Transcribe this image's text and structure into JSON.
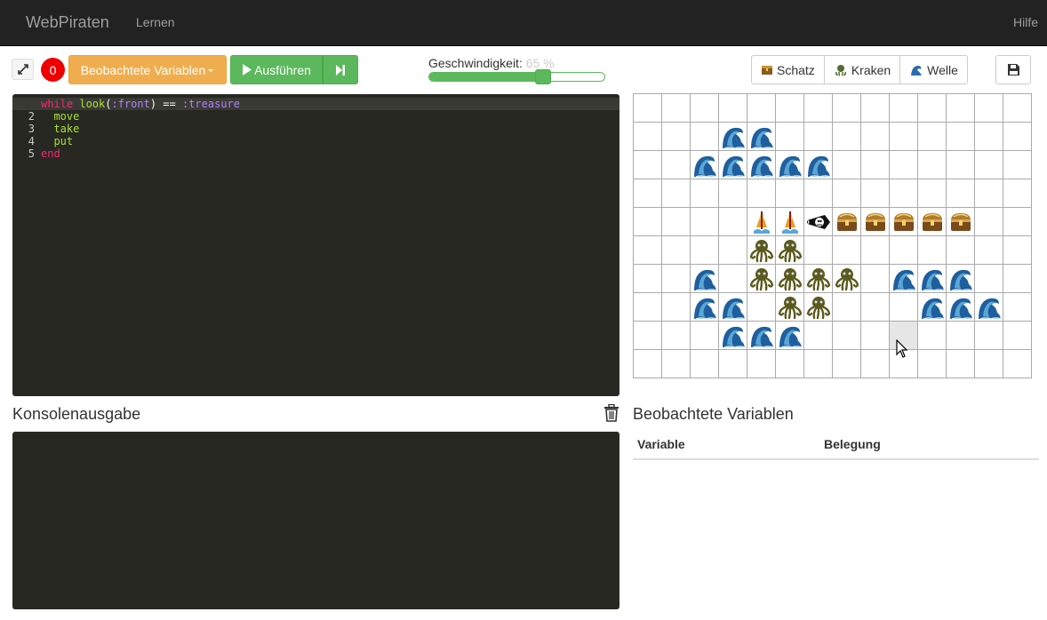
{
  "nav": {
    "brand": "WebPiraten",
    "learn": "Lernen",
    "help": "Hilfe"
  },
  "toolbar": {
    "error_count": "0",
    "watch_label": "Beobachtete Variablen",
    "run_label": "Ausführen",
    "speed_label": "Geschwindigkeit:",
    "speed_value": "65 %",
    "speed_level": 0.65,
    "treasure_label": "Schatz",
    "kraken_label": "Kraken",
    "wave_label": "Welle"
  },
  "editor": {
    "line_numbers": [
      "1",
      "2",
      "3",
      "4",
      "5"
    ]
  },
  "console": {
    "title": "Konsolenausgabe"
  },
  "watch": {
    "title": "Beobachtete Variablen",
    "col_variable": "Variable",
    "col_value": "Belegung"
  },
  "grid": {
    "cols": 14,
    "rows": 10,
    "cells": [
      [
        1,
        3,
        "wave"
      ],
      [
        1,
        4,
        "wave"
      ],
      [
        2,
        2,
        "wave"
      ],
      [
        2,
        3,
        "wave"
      ],
      [
        2,
        4,
        "wave"
      ],
      [
        2,
        5,
        "wave"
      ],
      [
        2,
        6,
        "wave"
      ],
      [
        4,
        4,
        "buoy"
      ],
      [
        4,
        5,
        "buoy"
      ],
      [
        4,
        6,
        "ship"
      ],
      [
        4,
        7,
        "treasure"
      ],
      [
        4,
        8,
        "treasure"
      ],
      [
        4,
        9,
        "treasure"
      ],
      [
        4,
        10,
        "treasure"
      ],
      [
        4,
        11,
        "treasure"
      ],
      [
        5,
        4,
        "kraken"
      ],
      [
        5,
        5,
        "kraken"
      ],
      [
        6,
        2,
        "wave"
      ],
      [
        6,
        4,
        "kraken"
      ],
      [
        6,
        5,
        "kraken"
      ],
      [
        6,
        6,
        "kraken"
      ],
      [
        6,
        7,
        "kraken"
      ],
      [
        6,
        9,
        "wave"
      ],
      [
        6,
        10,
        "wave"
      ],
      [
        6,
        11,
        "wave"
      ],
      [
        7,
        2,
        "wave"
      ],
      [
        7,
        3,
        "wave"
      ],
      [
        7,
        5,
        "kraken"
      ],
      [
        7,
        6,
        "kraken"
      ],
      [
        7,
        10,
        "wave"
      ],
      [
        7,
        11,
        "wave"
      ],
      [
        7,
        12,
        "wave"
      ],
      [
        8,
        3,
        "wave"
      ],
      [
        8,
        4,
        "wave"
      ],
      [
        8,
        5,
        "wave"
      ]
    ],
    "highlight": [
      8,
      9
    ]
  }
}
